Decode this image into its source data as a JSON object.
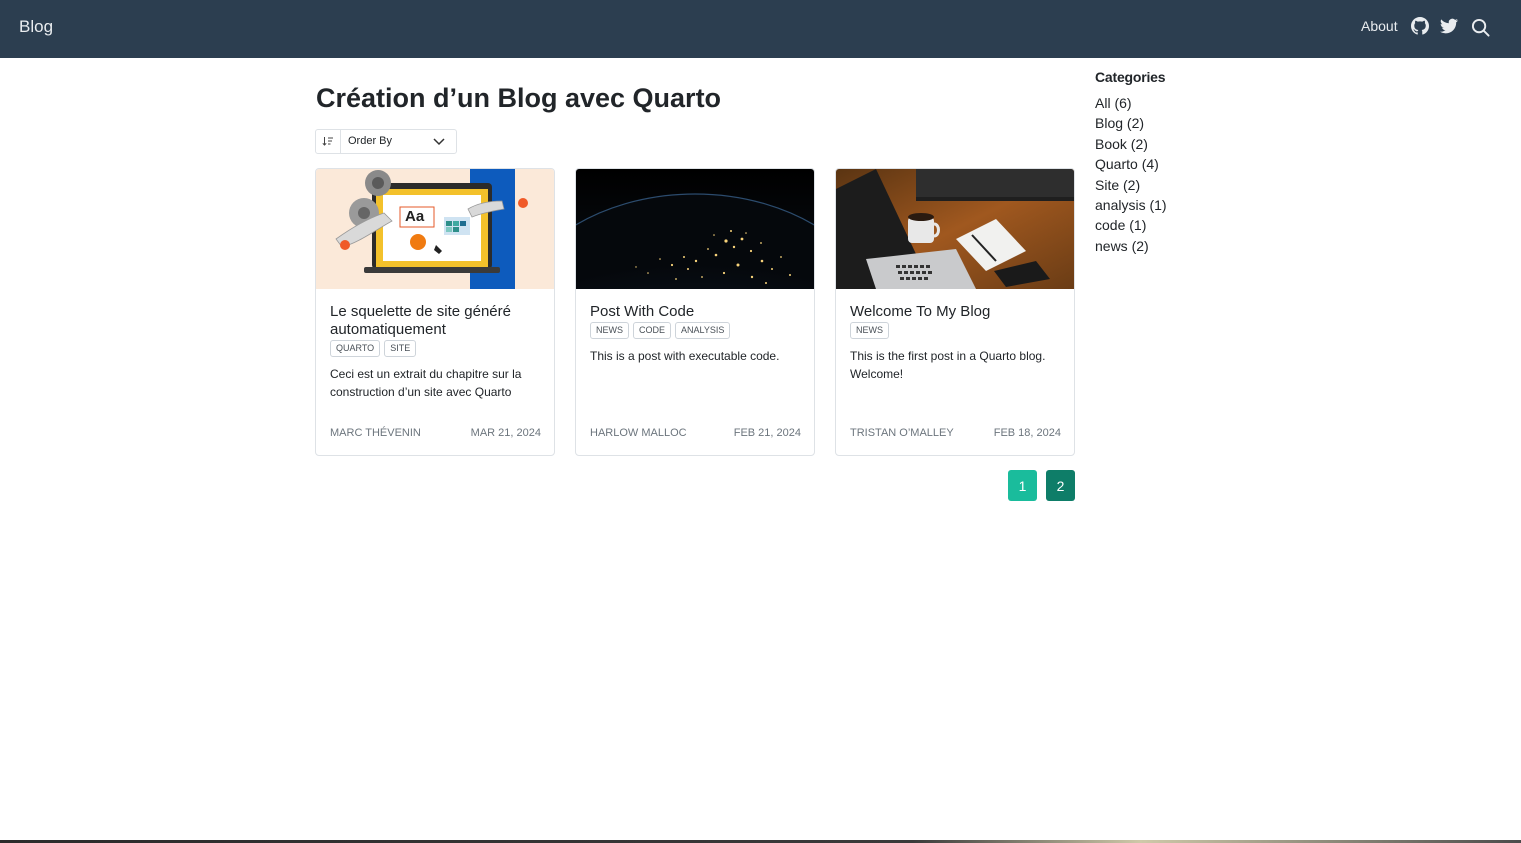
{
  "navbar": {
    "brand": "Blog",
    "about": "About",
    "icons": [
      "github-icon",
      "twitter-icon",
      "search-icon"
    ],
    "background": "#2c3e50"
  },
  "main": {
    "title": "Création d’un Blog avec Quarto",
    "order_by": {
      "label": "Order By",
      "icon": "sort-icon"
    }
  },
  "posts": [
    {
      "title": "Le squelette de site généré automatiquement",
      "categories": [
        "QUARTO",
        "SITE"
      ],
      "description": "Ceci est un extrait du chapitre sur la construction d’un site avec Quarto",
      "author": "MARC THÉVENIN",
      "date": "MAR 21, 2024",
      "image": "design-illustration"
    },
    {
      "title": "Post With Code",
      "categories": [
        "NEWS",
        "CODE",
        "ANALYSIS"
      ],
      "description": "This is a post with executable code.",
      "author": "HARLOW MALLOC",
      "date": "FEB 21, 2024",
      "image": "earth-at-night"
    },
    {
      "title": "Welcome To My Blog",
      "categories": [
        "NEWS"
      ],
      "description": "This is the first post in a Quarto blog. Welcome!",
      "author": "TRISTAN O’MALLEY",
      "date": "FEB 18, 2024",
      "image": "desk-laptop-coffee"
    }
  ],
  "pagination": {
    "pages": [
      "1",
      "2"
    ],
    "current": "2",
    "colors": {
      "page": "#1abc9c",
      "active": "#0e7d68"
    }
  },
  "sidebar": {
    "title": "Categories",
    "items": [
      "All (6)",
      "Blog (2)",
      "Book (2)",
      "Quarto (4)",
      "Site (2)",
      "analysis (1)",
      "code (1)",
      "news (2)"
    ]
  }
}
